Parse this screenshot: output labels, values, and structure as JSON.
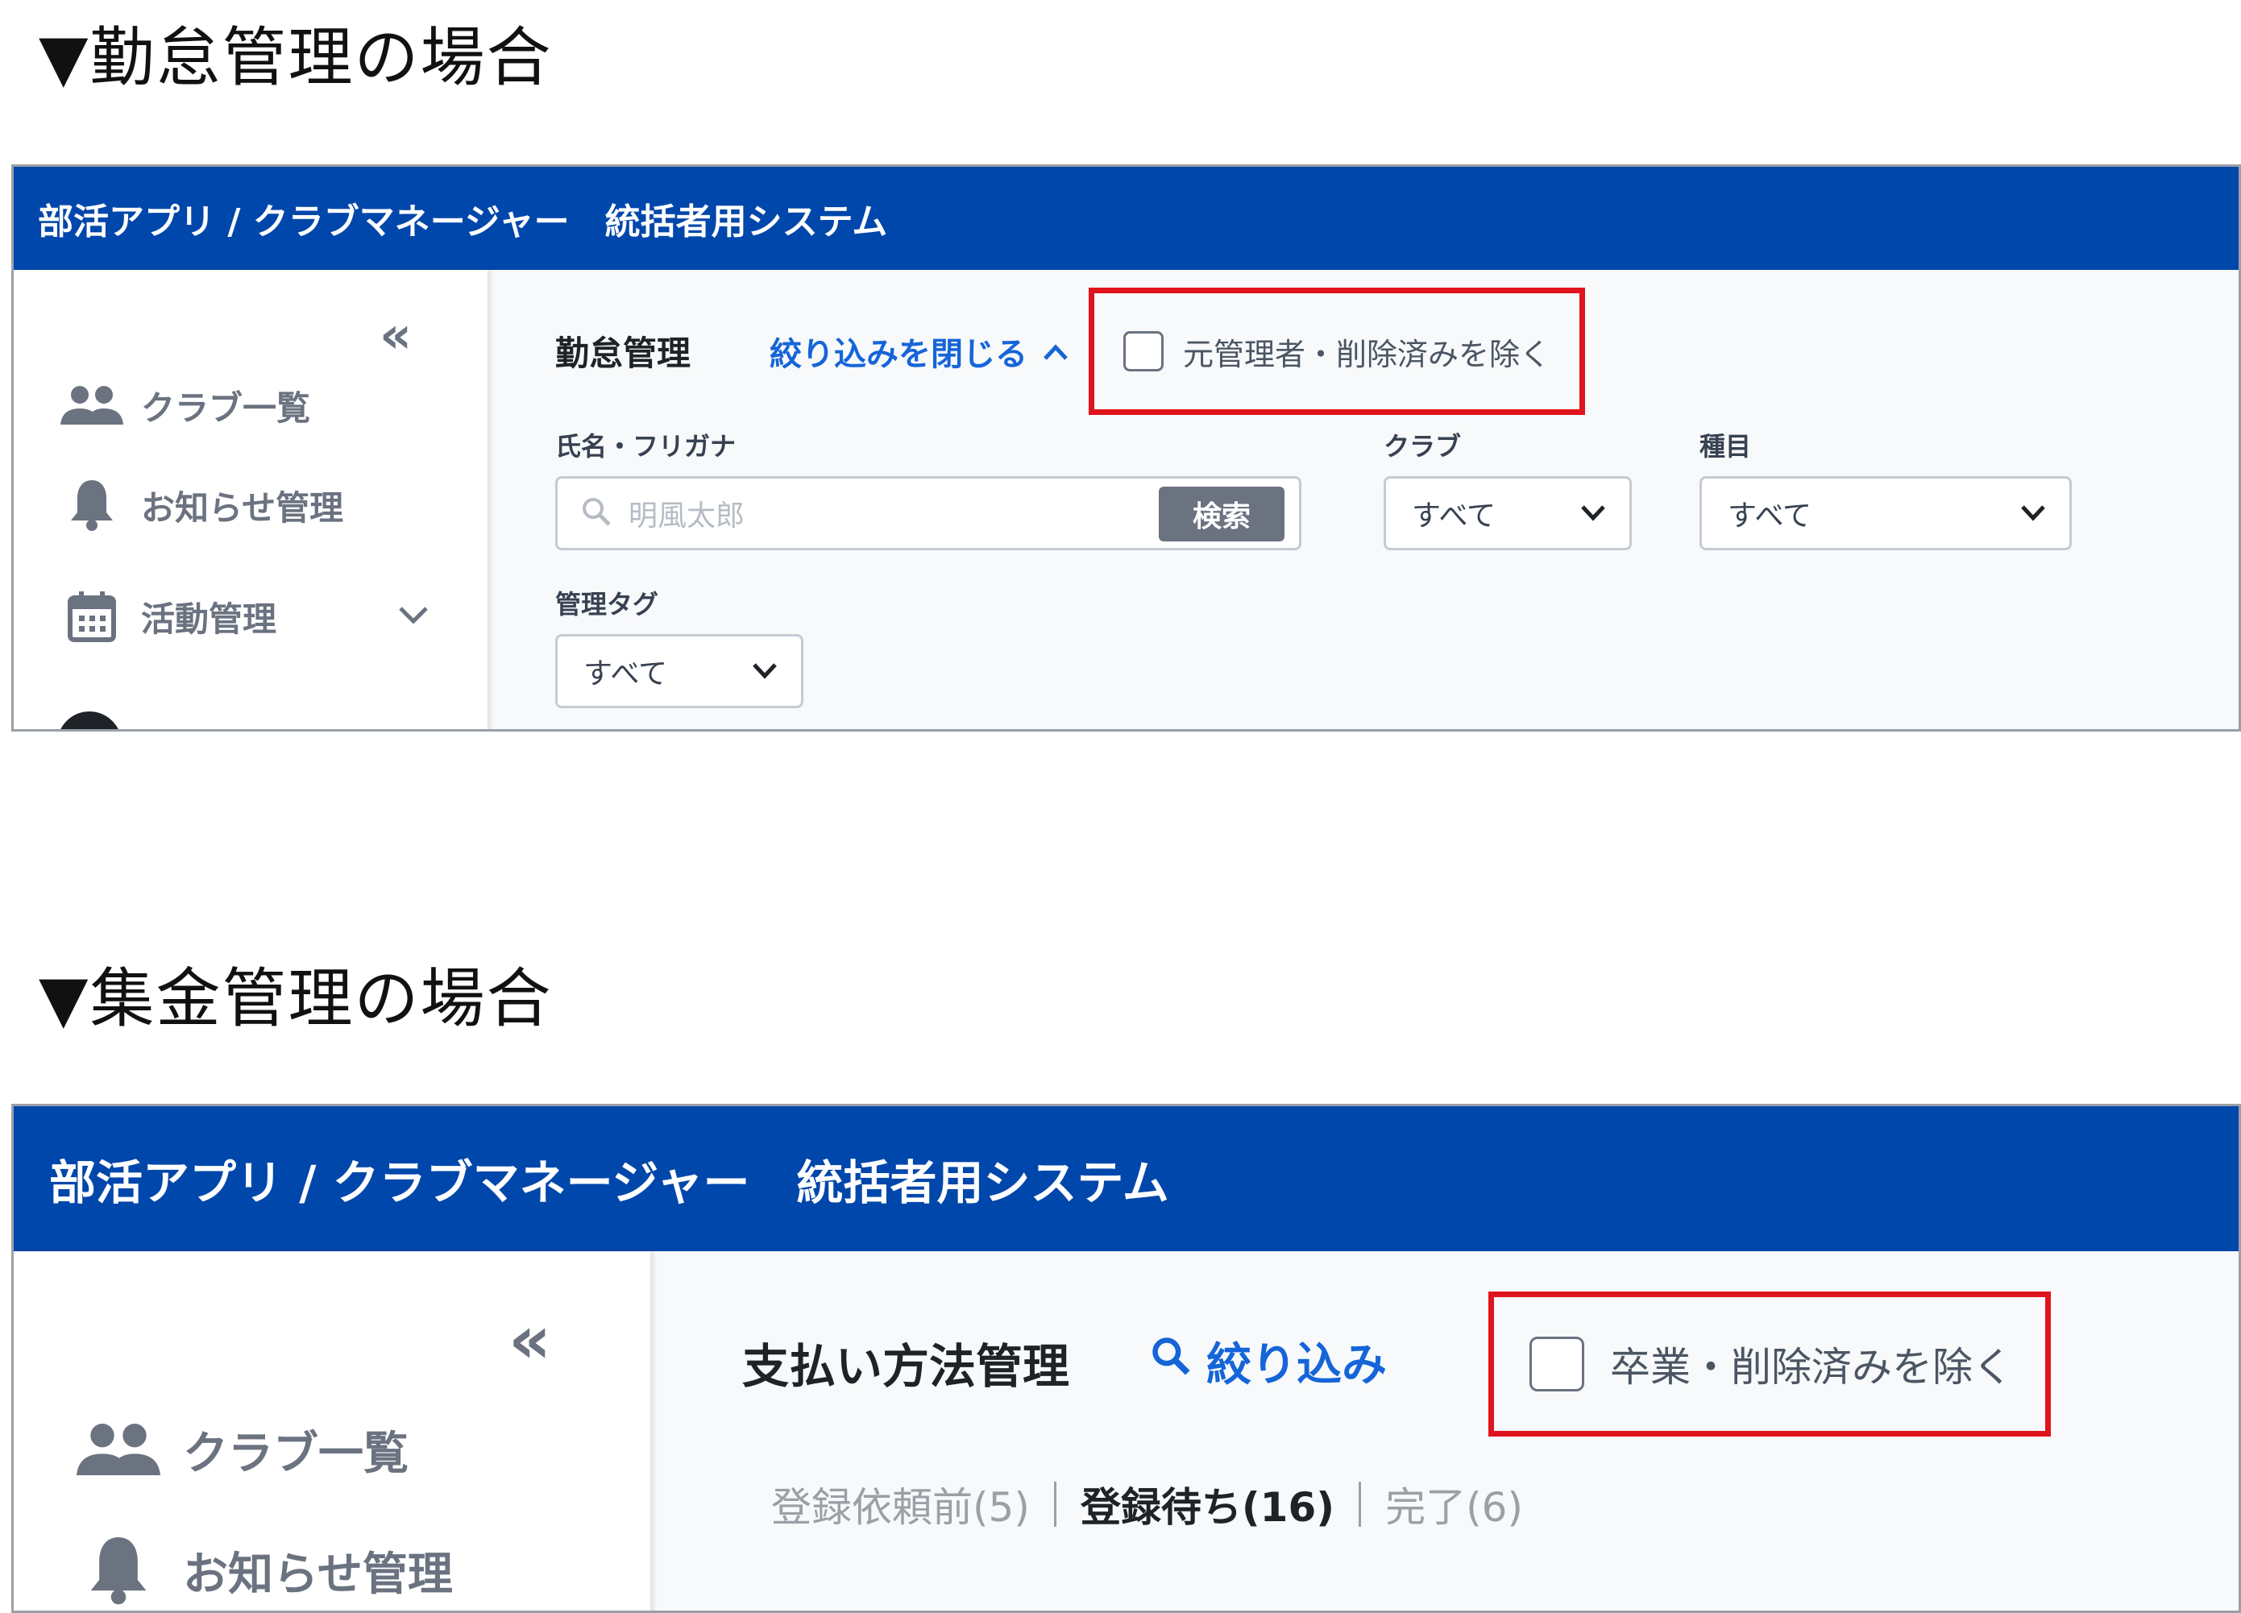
{
  "sections": [
    {
      "heading": "▼勤怠管理の場合",
      "app_title": "部活アプリ / クラブマネージャー　統括者用システム",
      "sidebar": {
        "items": [
          {
            "label": "クラブ一覧",
            "icon": "people-icon"
          },
          {
            "label": "お知らせ管理",
            "icon": "bell-icon"
          },
          {
            "label": "活動管理",
            "icon": "calendar-icon"
          }
        ]
      },
      "page_title": "勤怠管理",
      "filter_toggle": "絞り込みを閉じる",
      "exclude_checkbox": {
        "label": "元管理者・削除済みを除く",
        "checked": false
      },
      "filters": {
        "name": {
          "label": "氏名・フリガナ",
          "placeholder": "明風太郎",
          "button": "検索"
        },
        "club": {
          "label": "クラブ",
          "value": "すべて"
        },
        "event": {
          "label": "種目",
          "value": "すべて"
        },
        "tag": {
          "label": "管理タグ",
          "value": "すべて"
        }
      }
    },
    {
      "heading": "▼集金管理の場合",
      "app_title": "部活アプリ / クラブマネージャー　統括者用システム",
      "sidebar": {
        "items": [
          {
            "label": "クラブ一覧",
            "icon": "people-icon"
          },
          {
            "label": "お知らせ管理",
            "icon": "bell-icon"
          }
        ]
      },
      "page_title": "支払い方法管理",
      "filter_toggle": "絞り込み",
      "exclude_checkbox": {
        "label": "卒業・削除済みを除く",
        "checked": false
      },
      "tabs": [
        {
          "label": "登録依頼前(5)",
          "active": false
        },
        {
          "label": "登録待ち(16)",
          "active": true
        },
        {
          "label": "完了(6)",
          "active": false
        }
      ]
    }
  ],
  "colors": {
    "header_bg": "#0047ab",
    "link": "#1565d8",
    "highlight_border": "#e0141c"
  }
}
